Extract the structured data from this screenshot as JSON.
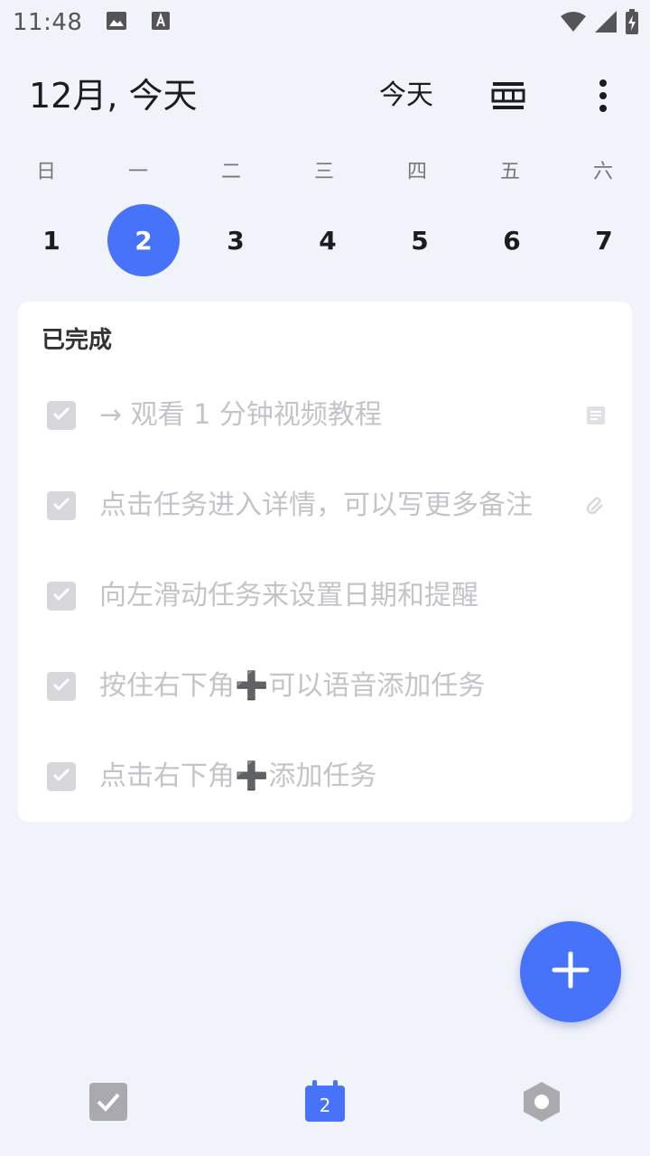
{
  "status_bar": {
    "time": "11:48",
    "icons_left": [
      "image-icon",
      "text-a-icon"
    ],
    "icons_right": [
      "wifi-icon",
      "signal-icon",
      "battery-charging-icon"
    ]
  },
  "header": {
    "title": "12月, 今天",
    "today_label": "今天",
    "view_icon": "calendar-view-icon",
    "more_icon": "more-vertical-icon"
  },
  "week": {
    "weekdays": [
      "日",
      "一",
      "二",
      "三",
      "四",
      "五",
      "六"
    ],
    "dates": [
      "1",
      "2",
      "3",
      "4",
      "5",
      "6",
      "7"
    ],
    "selected_date": "2"
  },
  "completed_section": {
    "title": "已完成",
    "tasks": [
      {
        "text": "→ 观看 1 分钟视频教程",
        "checked": true,
        "trailing_icon": "note-icon"
      },
      {
        "text": "点击任务进入详情，可以写更多备注",
        "checked": true,
        "trailing_icon": "attachment-icon"
      },
      {
        "text": "向左滑动任务来设置日期和提醒",
        "checked": true
      },
      {
        "text": "按住右下角➕可以语音添加任务",
        "checked": true
      },
      {
        "text": "点击右下角➕添加任务",
        "checked": true
      }
    ]
  },
  "fab": {
    "icon": "plus-icon"
  },
  "bottom_nav": {
    "items": [
      {
        "icon": "task-check-icon",
        "active": false
      },
      {
        "icon": "calendar-icon",
        "badge": "2",
        "active": true
      },
      {
        "icon": "settings-hexagon-icon",
        "active": false
      }
    ]
  },
  "colors": {
    "accent": "#4772fa",
    "background": "#f1f3fb",
    "completed_text": "#c4c4c8"
  }
}
